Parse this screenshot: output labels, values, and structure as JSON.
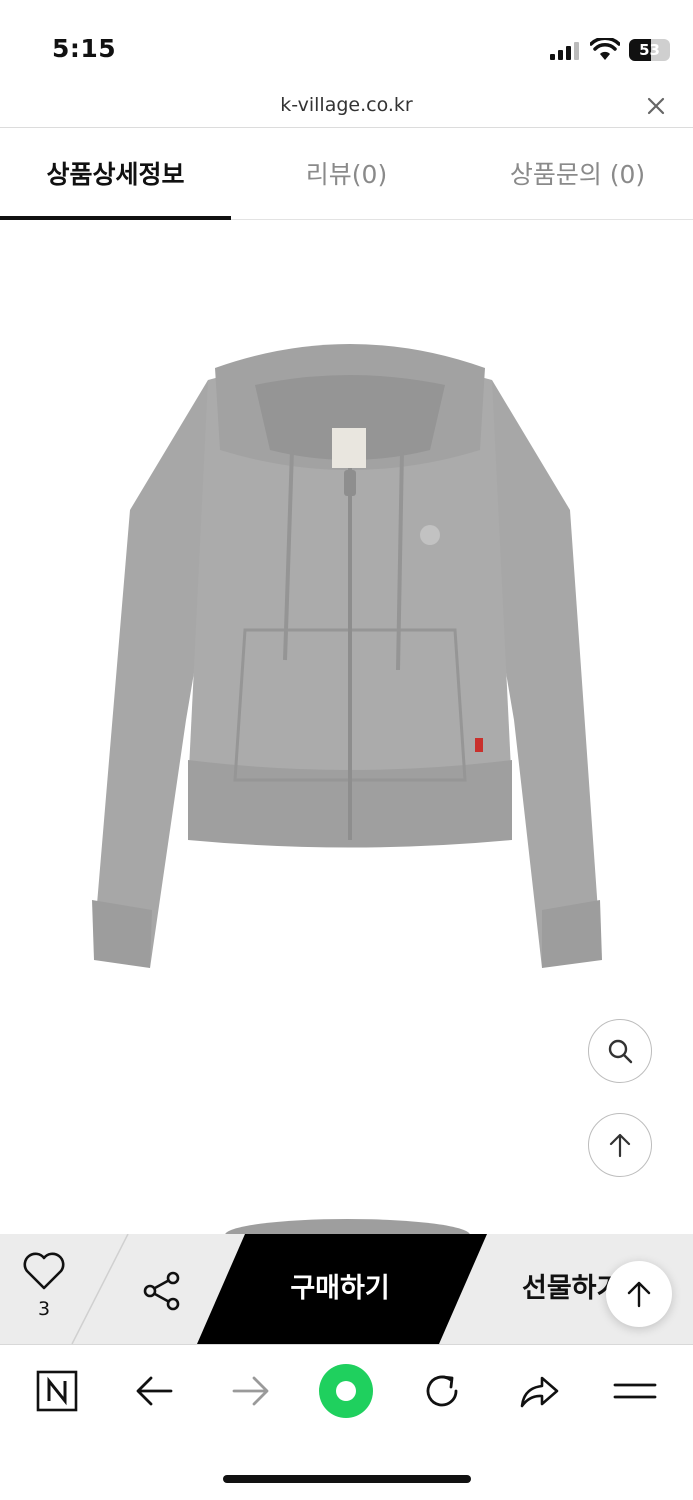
{
  "status_bar": {
    "time": "5:15",
    "battery": "53",
    "battery_level_percent": 53
  },
  "browser": {
    "url": "k-village.co.kr",
    "close_icon": "close-icon"
  },
  "tabs": [
    {
      "label": "상품상세정보",
      "active": true
    },
    {
      "label": "리뷰(0)",
      "active": false
    },
    {
      "label": "상품문의 (0)",
      "active": false
    }
  ],
  "product": {
    "image_icon": "gray-zip-hoodie-image"
  },
  "floating": {
    "search_icon": "magnifier-icon",
    "top_icon": "arrow-up-icon"
  },
  "purchase_bar": {
    "like_count": "3",
    "buy_label": "구매하기",
    "gift_label": "선물하기",
    "colors": {
      "buy_bg": "#000000",
      "bar_bg": "#ececec"
    }
  },
  "toolbar": {
    "icons": [
      "naver-n-icon",
      "back-arrow-icon",
      "forward-arrow-icon",
      "home-green-icon",
      "reload-icon",
      "share-icon",
      "menu-icon"
    ],
    "colors": {
      "home": "#1fd05e"
    }
  }
}
